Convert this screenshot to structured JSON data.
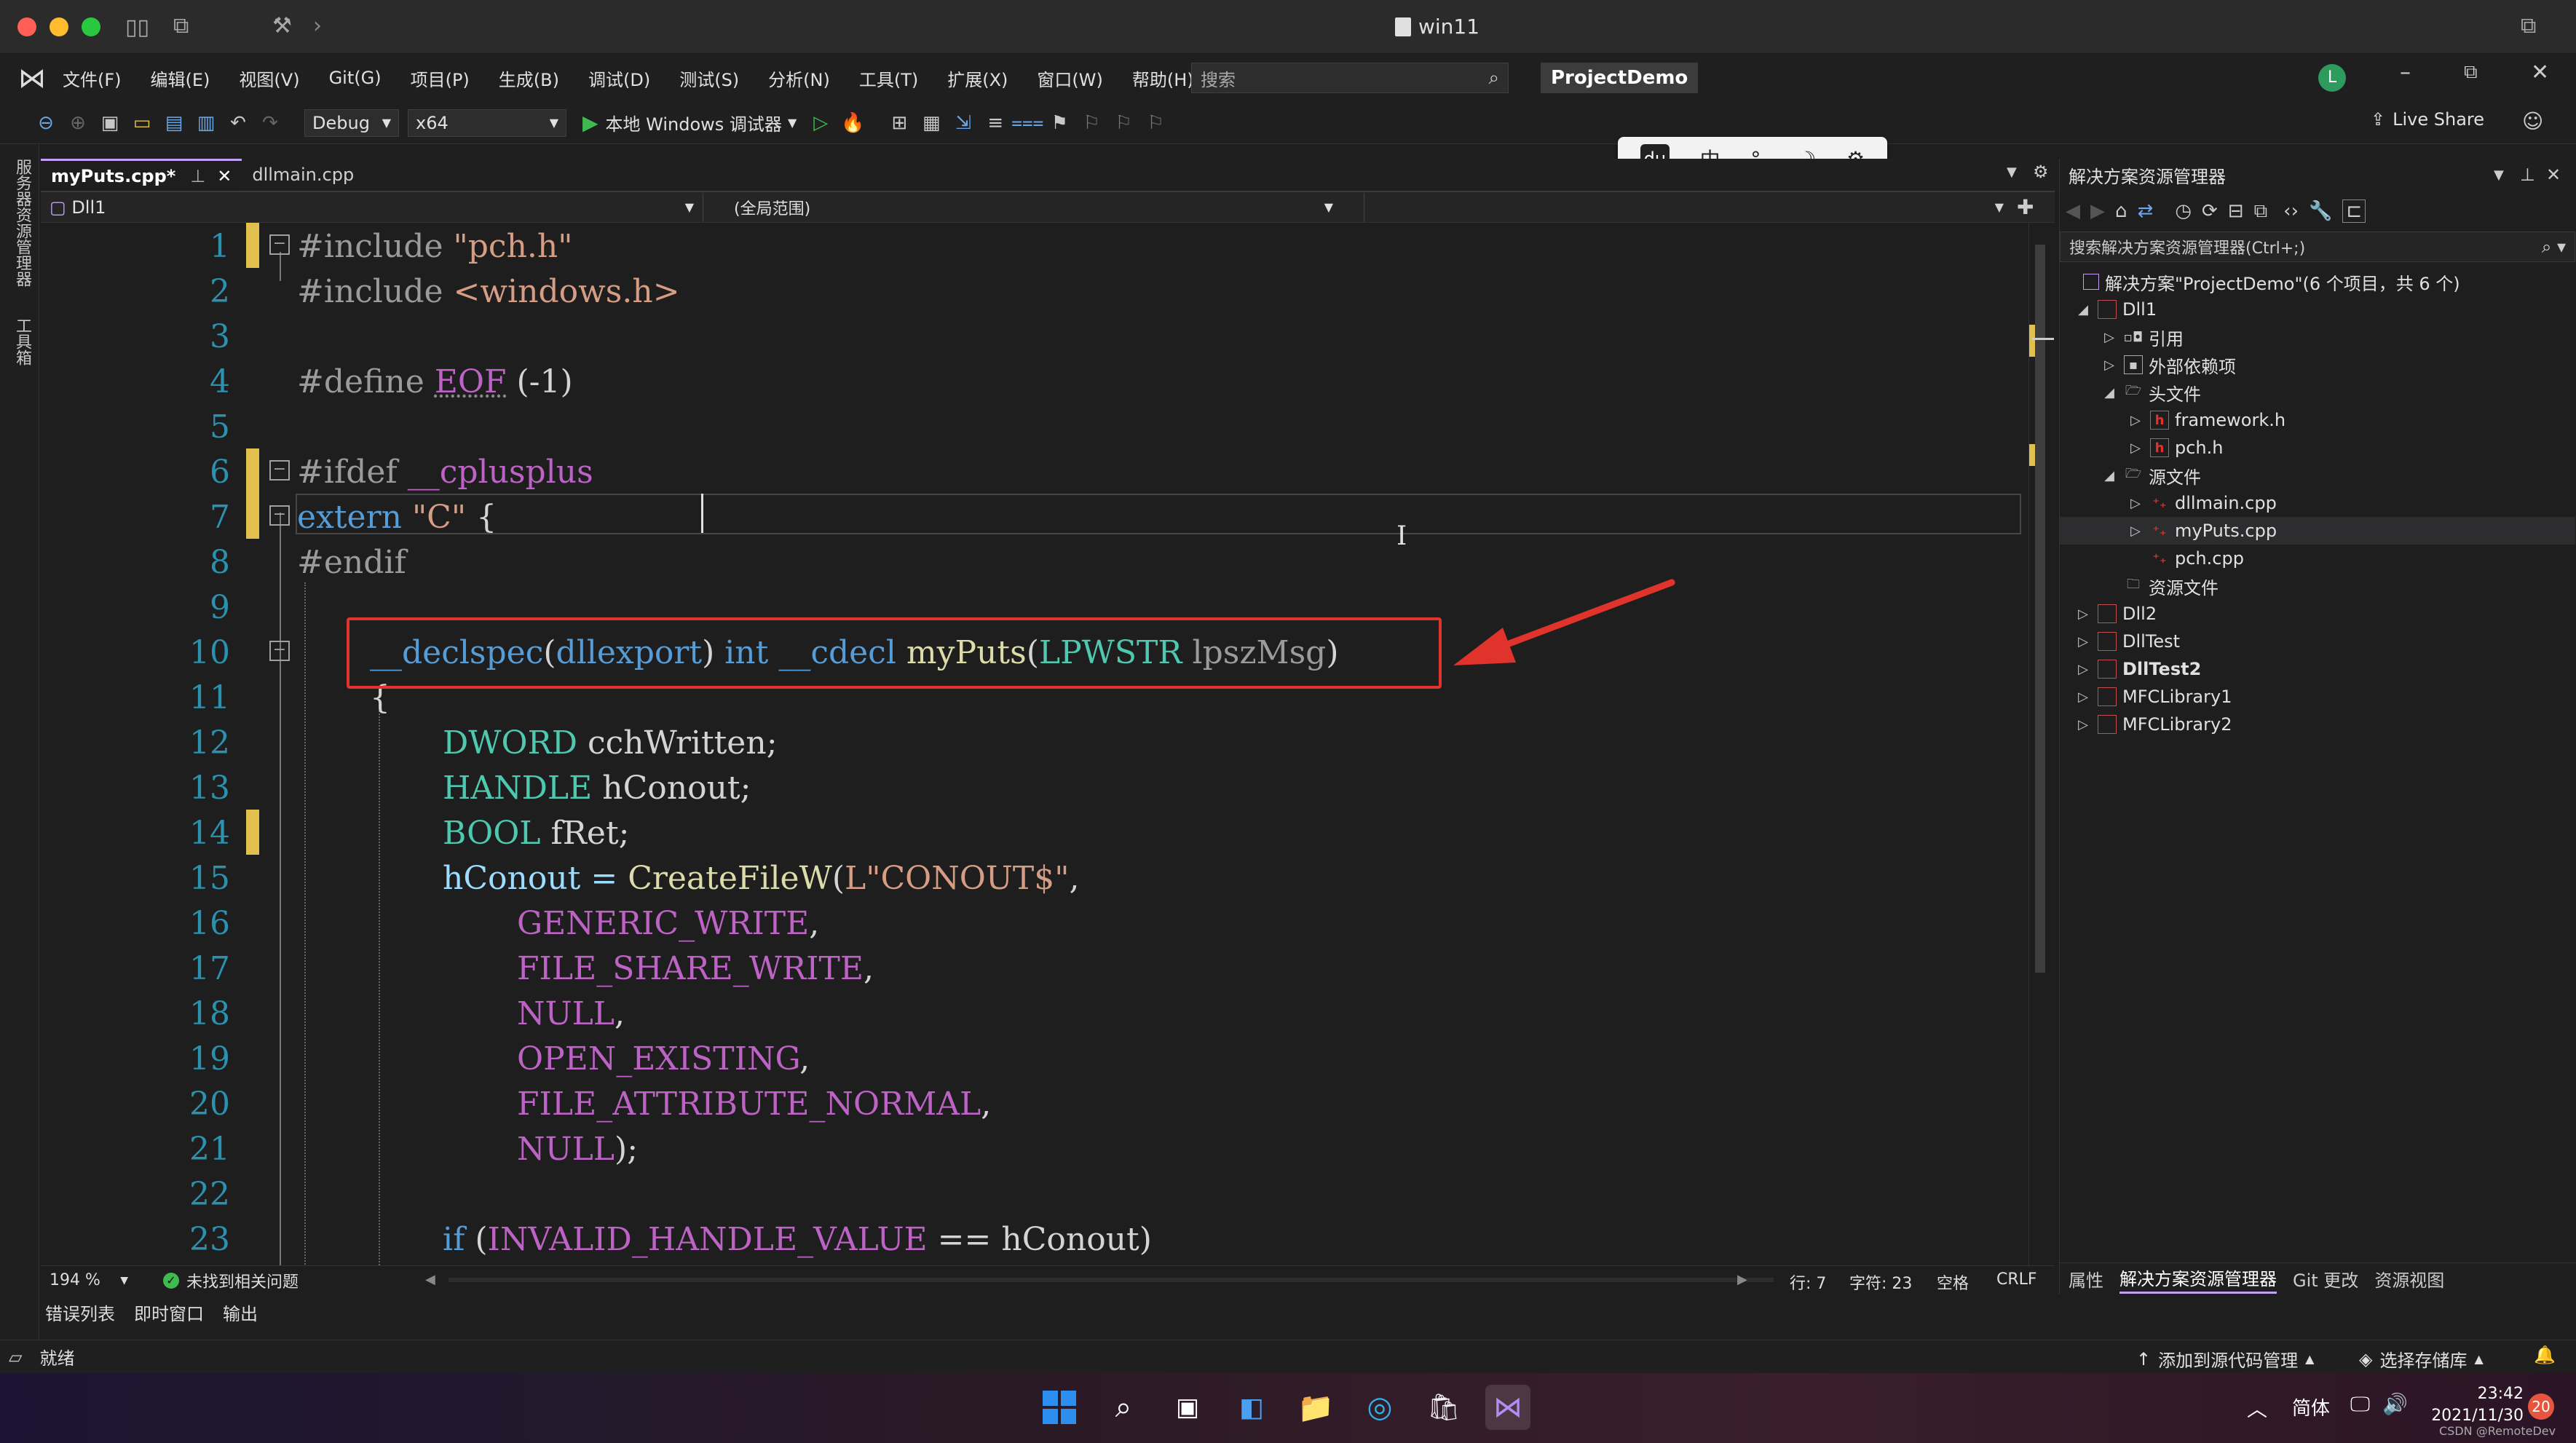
{
  "window": {
    "title": "win11"
  },
  "menu": {
    "items": [
      "文件(F)",
      "编辑(E)",
      "视图(V)",
      "Git(G)",
      "项目(P)",
      "生成(B)",
      "调试(D)",
      "测试(S)",
      "分析(N)",
      "工具(T)",
      "扩展(X)",
      "窗口(W)",
      "帮助(H)"
    ],
    "search_placeholder": "搜索",
    "project_name": "ProjectDemo",
    "user_initial": "L"
  },
  "toolbar": {
    "config": "Debug",
    "platform": "x64",
    "debugger": "本地 Windows 调试器",
    "live_share": "Live Share"
  },
  "ime_bar": {
    "items": [
      "中",
      "°,",
      "☽",
      "⚙"
    ]
  },
  "left_strip": {
    "labels": [
      "服务器资源管理器",
      "工具箱"
    ]
  },
  "editor": {
    "tabs": [
      {
        "label": "myPuts.cpp*",
        "pin": "⊥",
        "close": "✕"
      },
      {
        "label": "dllmain.cpp"
      }
    ],
    "nav_project": "Dll1",
    "nav_scope": "(全局范围)",
    "lines": [
      "1",
      "2",
      "3",
      "4",
      "5",
      "6",
      "7",
      "8",
      "9",
      "10",
      "11",
      "12",
      "13",
      "14",
      "15",
      "16",
      "17",
      "18",
      "19",
      "20",
      "21",
      "22",
      "23"
    ],
    "code": {
      "l1a": "#include ",
      "l1b": "\"pch.h\"",
      "l2a": "#include ",
      "l2b": "<windows.h>",
      "l4a": "#define ",
      "l4b": "EOF",
      "l4c": " (-1)",
      "l6a": "#ifdef ",
      "l6b": "__cplusplus",
      "l7a": "extern ",
      "l7b": "\"C\"",
      "l7c": " {",
      "l8": "#endif",
      "l10a": "__declspec",
      "l10b": "(",
      "l10c": "dllexport",
      "l10d": ") ",
      "l10e": "int",
      "l10f": " ",
      "l10g": "__cdecl",
      "l10h": " ",
      "l10i": "myPuts",
      "l10j": "(",
      "l10k": "LPWSTR",
      "l10l": " ",
      "l10m": "lpszMsg",
      "l10n": ")",
      "l11": "{",
      "l12a": "DWORD",
      "l12b": " cchWritten;",
      "l13a": "HANDLE",
      "l13b": " hConout;",
      "l14a": "BOOL",
      "l14b": " fRet;",
      "l15a": "hConout = ",
      "l15b": "CreateFileW",
      "l15c": "(",
      "l15d": "L\"CONOUT$\"",
      "l15e": ",",
      "l16a": "GENERIC_WRITE",
      "l16b": ",",
      "l17a": "FILE_SHARE_WRITE",
      "l17b": ",",
      "l18a": "NULL",
      "l18b": ",",
      "l19a": "OPEN_EXISTING",
      "l19b": ",",
      "l20a": "FILE_ATTRIBUTE_NORMAL",
      "l20b": ",",
      "l21a": "NULL",
      "l21b": ");",
      "l23a": "if",
      "l23b": " (",
      "l23c": "INVALID_HANDLE_VALUE",
      "l23d": " == hConout)"
    },
    "zoom": "194 %",
    "issues": "未找到相关问题",
    "row": "行: 7",
    "col": "字符: 23",
    "whitespace": "空格",
    "eol": "CRLF"
  },
  "bottom_tabs": [
    "错误列表",
    "即时窗口",
    "输出"
  ],
  "status": {
    "ready": "就绪",
    "add_source": "添加到源代码管理",
    "select_repo": "选择存储库"
  },
  "solution": {
    "title": "解决方案资源管理器",
    "search_placeholder": "搜索解决方案资源管理器(Ctrl+;)",
    "root": "解决方案\"ProjectDemo\"(6 个项目，共 6 个)",
    "items": {
      "dll1": "Dll1",
      "refs": "引用",
      "extdeps": "外部依赖项",
      "headers": "头文件",
      "framework": "framework.h",
      "pchh": "pch.h",
      "sources": "源文件",
      "dllmain": "dllmain.cpp",
      "myputs": "myPuts.cpp",
      "pchcpp": "pch.cpp",
      "resources": "资源文件",
      "dll2": "Dll2",
      "dlltest": "DllTest",
      "dlltest2": "DllTest2",
      "mfc1": "MFCLibrary1",
      "mfc2": "MFCLibrary2"
    },
    "bottom_tabs": [
      "属性",
      "解决方案资源管理器",
      "Git 更改",
      "资源视图"
    ]
  },
  "taskbar": {
    "lang": "简体",
    "time": "23:42",
    "date": "2021/11/30",
    "badge": "20",
    "watermark": "CSDN @RemoteDev"
  },
  "colors": {
    "accent_red": "#e0332b",
    "change_bar": "#e2c04e",
    "line_number": "#2b91af"
  }
}
